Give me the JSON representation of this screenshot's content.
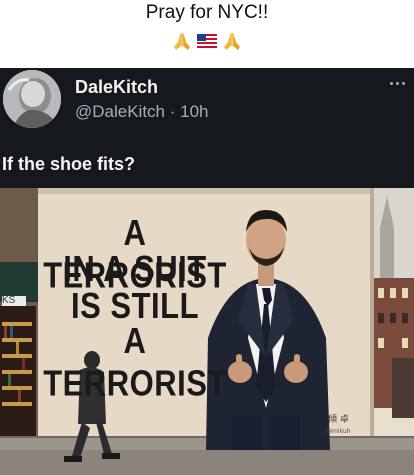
{
  "caption": {
    "text": "Pray for NYC!!",
    "emoji": [
      "folded-hands",
      "us-flag",
      "folded-hands"
    ]
  },
  "tweet": {
    "display_name": "DaleKitch",
    "handle": "@DaleKitch",
    "time": "10h",
    "text": "If the shoe fits?",
    "more_icon": "ellipsis-icon"
  },
  "media": {
    "poster_lines": [
      "A TERRORIST",
      "IN A SUIT",
      "IS STILL",
      "A TERRORIST"
    ],
    "shop_sign": "KS",
    "colors": {
      "wall": "#e6dac6",
      "suit": "#1e2431",
      "storefront": "#1f3a32",
      "sky": "#d8d4cc"
    }
  }
}
